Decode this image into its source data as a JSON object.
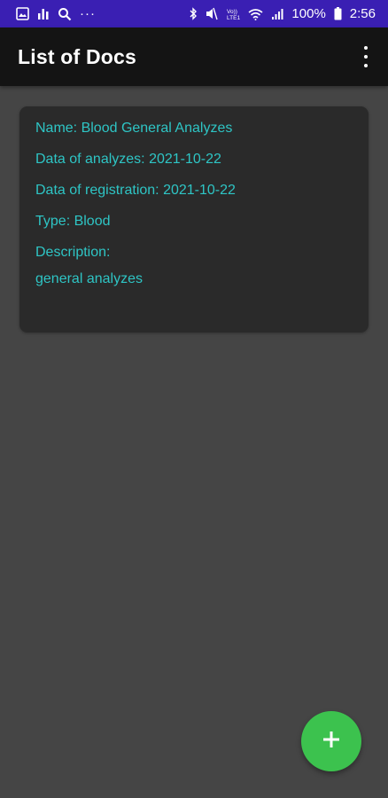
{
  "status_bar": {
    "battery": "100%",
    "time": "2:56",
    "dots": "···"
  },
  "app_bar": {
    "title": "List of Docs"
  },
  "card": {
    "name": "Name: Blood General Analyzes",
    "data_of_analyzes": "Data of analyzes: 2021-10-22",
    "data_of_registration": "Data of registration: 2021-10-22",
    "type": "Type: Blood",
    "description_label": "Description:",
    "description_value": "general analyzes"
  },
  "fab": {
    "icon": "plus-icon"
  },
  "colors": {
    "status_bar": "#3a1fb3",
    "app_bar": "#141414",
    "background": "#454545",
    "card": "#2a2a2a",
    "card_text": "#2ec5c5",
    "fab": "#3cc24e"
  }
}
